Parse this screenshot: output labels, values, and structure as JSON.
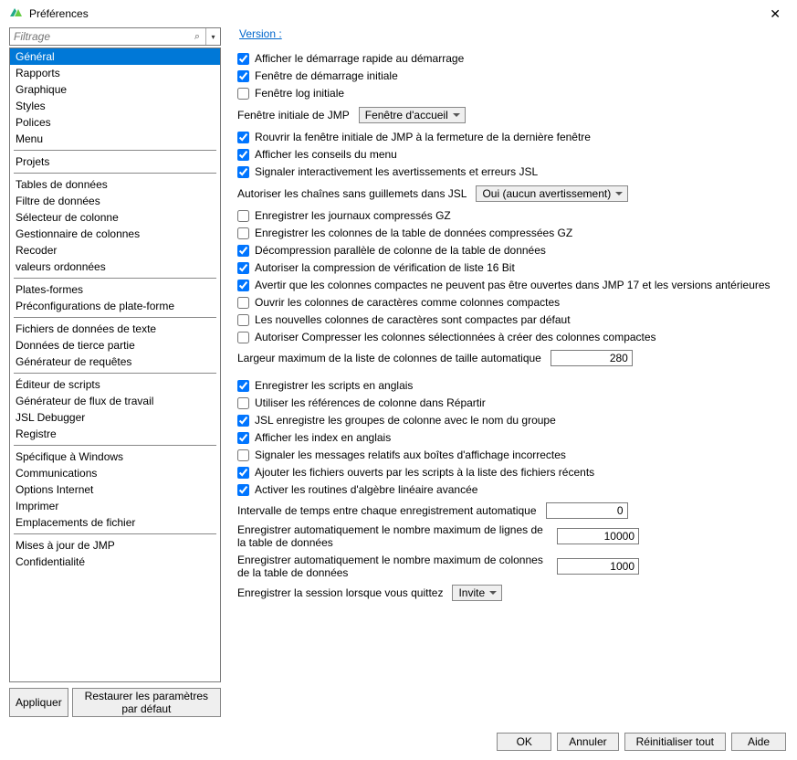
{
  "window": {
    "title": "Préférences"
  },
  "filter": {
    "placeholder": "Filtrage"
  },
  "categories": [
    {
      "label": "Général",
      "selected": true
    },
    {
      "label": "Rapports"
    },
    {
      "label": "Graphique"
    },
    {
      "label": "Styles"
    },
    {
      "label": "Polices"
    },
    {
      "label": "Menu"
    },
    {
      "sep": true
    },
    {
      "label": "Projets"
    },
    {
      "sep": true
    },
    {
      "label": "Tables de données"
    },
    {
      "label": "Filtre de données"
    },
    {
      "label": "Sélecteur de colonne"
    },
    {
      "label": "Gestionnaire de colonnes"
    },
    {
      "label": "Recoder"
    },
    {
      "label": "valeurs ordonnées"
    },
    {
      "sep": true
    },
    {
      "label": "Plates-formes"
    },
    {
      "label": "Préconfigurations de plate-forme"
    },
    {
      "sep": true
    },
    {
      "label": "Fichiers de données de texte"
    },
    {
      "label": "Données de tierce partie"
    },
    {
      "label": "Générateur de requêtes"
    },
    {
      "sep": true
    },
    {
      "label": "Éditeur de scripts"
    },
    {
      "label": "Générateur de flux de travail"
    },
    {
      "label": "JSL Debugger"
    },
    {
      "label": "Registre"
    },
    {
      "sep": true
    },
    {
      "label": "Spécifique à Windows"
    },
    {
      "label": "Communications"
    },
    {
      "label": "Options Internet"
    },
    {
      "label": "Imprimer"
    },
    {
      "label": "Emplacements de fichier"
    },
    {
      "sep": true
    },
    {
      "label": "Mises à jour de JMP"
    },
    {
      "label": "Confidentialité"
    }
  ],
  "sidebar_buttons": {
    "apply": "Appliquer",
    "reset_defaults": "Restaurer les paramètres par défaut"
  },
  "version_link": "Version :",
  "opts": {
    "show_quickstart": "Afficher le démarrage rapide au démarrage",
    "initial_splash": "Fenêtre de démarrage initiale",
    "initial_log": "Fenêtre log initiale",
    "initial_window_lbl": "Fenêtre initiale de JMP",
    "initial_window_val": "Fenêtre d'accueil",
    "reopen_initial": "Rouvrir la fenêtre initiale de JMP à la fermeture de la dernière fenêtre",
    "show_menu_tips": "Afficher les conseils du menu",
    "report_jsl": "Signaler interactivement les avertissements et erreurs JSL",
    "unquoted_lbl": "Autoriser les chaînes sans guillemets dans JSL",
    "unquoted_val": "Oui (aucun avertissement)",
    "gz_log": "Enregistrer les journaux compressés GZ",
    "gz_cols": "Enregistrer les colonnes de la table de données compressées GZ",
    "parallel_decompress": "Décompression parallèle de colonne de la table de données",
    "list16_compress": "Autoriser la compression de vérification de liste 16 Bit",
    "warn_compact": "Avertir que les colonnes compactes ne peuvent pas être ouvertes dans JMP 17 et les versions antérieures",
    "open_char_compact": "Ouvrir les colonnes de caractères comme colonnes compactes",
    "new_char_compact": "Les nouvelles colonnes de caractères sont compactes par défaut",
    "allow_compress_sel": "Autoriser Compresser les colonnes sélectionnées à créer des colonnes compactes",
    "max_col_width_lbl": "Largeur maximum de la liste de colonnes de taille automatique",
    "max_col_width_val": "280",
    "save_scripts_en": "Enregistrer les scripts en anglais",
    "use_col_refs": "Utiliser les références de colonne dans Répartir",
    "jsl_group_names": "JSL enregistre les groupes de colonne avec le nom du groupe",
    "show_index_en": "Afficher les index en anglais",
    "report_bad_display": "Signaler les messages relatifs aux boîtes d'affichage incorrectes",
    "add_script_files": "Ajouter les fichiers ouverts par les scripts à la liste des fichiers récents",
    "enable_adv_linalg": "Activer les routines d'algèbre linéaire avancée",
    "autosave_interval_lbl": "Intervalle de temps entre chaque enregistrement automatique",
    "autosave_interval_val": "0",
    "autosave_rows_lbl": "Enregistrer automatiquement le nombre maximum de lignes de la table de données",
    "autosave_rows_val": "10000",
    "autosave_cols_lbl": "Enregistrer automatiquement le nombre maximum de colonnes de la table de données",
    "autosave_cols_val": "1000",
    "save_session_lbl": "Enregistrer la session lorsque vous quittez",
    "save_session_val": "Invite"
  },
  "footer": {
    "ok": "OK",
    "cancel": "Annuler",
    "reset_all": "Réinitialiser tout",
    "help": "Aide"
  }
}
